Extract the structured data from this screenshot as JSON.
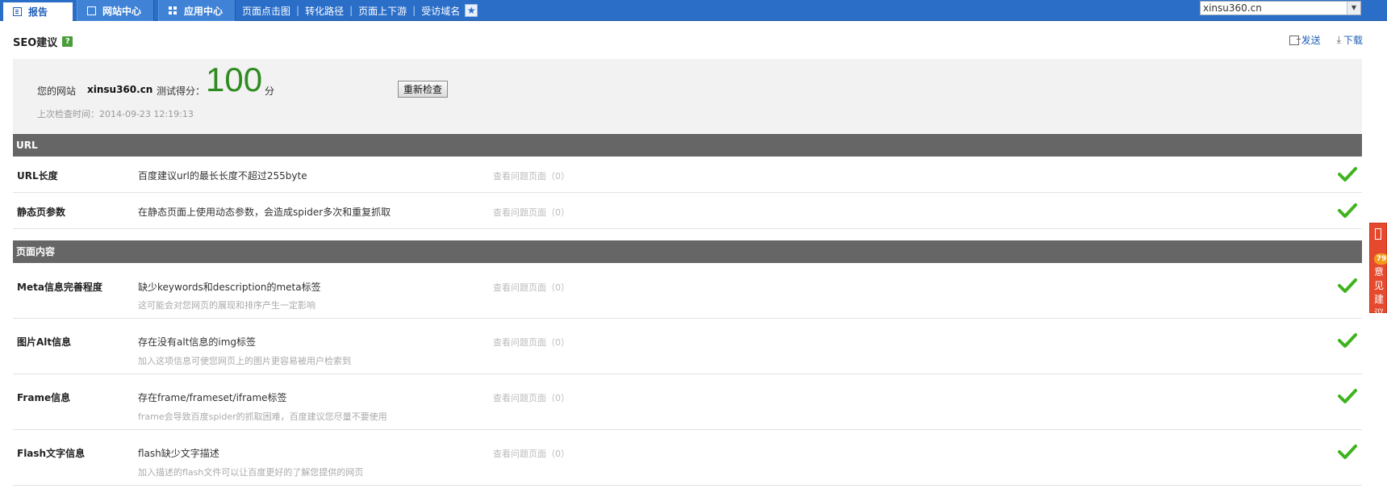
{
  "nav": {
    "tab_report": "报告",
    "tab_site": "网站中心",
    "tab_app": "应用中心",
    "links": [
      "页面点击图",
      "转化路径",
      "页面上下游",
      "受访域名"
    ],
    "separator": "|",
    "site_selected": "xinsu360.cn"
  },
  "header": {
    "title": "SEO建议",
    "help": "?",
    "send": "发送",
    "download": "下载"
  },
  "summary": {
    "site_label": "您的网站",
    "site": "xinsu360.cn",
    "score_label": "测试得分：",
    "score": "100",
    "score_unit": "分",
    "recheck": "重新检查",
    "last_check": "上次检查时间：2014-09-23 12:19:13"
  },
  "sections": [
    {
      "title": "URL",
      "rows": [
        {
          "name": "URL长度",
          "desc": "百度建议url的最长长度不超过255byte",
          "sub": "",
          "link": "查看问题页面（0）",
          "status": "pass"
        },
        {
          "name": "静态页参数",
          "desc": "在静态页面上使用动态参数，会造成spider多次和重复抓取",
          "sub": "",
          "link": "查看问题页面（0）",
          "status": "pass"
        }
      ]
    },
    {
      "title": "页面内容",
      "rows": [
        {
          "name": "Meta信息完善程度",
          "desc": "缺少keywords和description的meta标签",
          "sub": "这可能会对您网页的展现和排序产生一定影响",
          "link": "查看问题页面（0）",
          "status": "pass"
        },
        {
          "name": "图片Alt信息",
          "desc": "存在没有alt信息的img标签",
          "sub": "加入这项信息可使您网页上的图片更容易被用户检索到",
          "link": "查看问题页面（0）",
          "status": "pass"
        },
        {
          "name": "Frame信息",
          "desc": "存在frame/frameset/iframe标签",
          "sub": "frame会导致百度spider的抓取困难，百度建议您尽量不要使用",
          "link": "查看问题页面（0）",
          "status": "pass"
        },
        {
          "name": "Flash文字信息",
          "desc": "flash缺少文字描述",
          "sub": "加入描述的flash文件可以让百度更好的了解您提供的网页",
          "link": "查看问题页面（0）",
          "status": "pass"
        }
      ]
    }
  ],
  "feedback": {
    "badge": "79",
    "text": "意见建议"
  },
  "colors": {
    "nav_blue": "#2a6ec8",
    "score_green": "#2e8b1f",
    "check_green": "#3fb31f",
    "section_gray": "#666666",
    "feedback_red": "#e64a2e"
  },
  "icons": [
    "report-icon",
    "edit-icon",
    "grid-icon",
    "star-icon",
    "help-icon",
    "send-icon",
    "download-icon",
    "check-icon",
    "pen-icon"
  ]
}
